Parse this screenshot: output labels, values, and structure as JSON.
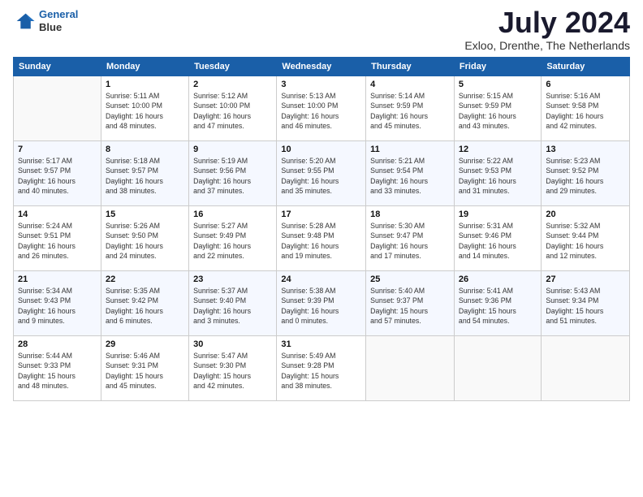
{
  "logo": {
    "line1": "General",
    "line2": "Blue"
  },
  "title": "July 2024",
  "subtitle": "Exloo, Drenthe, The Netherlands",
  "days_of_week": [
    "Sunday",
    "Monday",
    "Tuesday",
    "Wednesday",
    "Thursday",
    "Friday",
    "Saturday"
  ],
  "weeks": [
    [
      {
        "day": "",
        "info": ""
      },
      {
        "day": "1",
        "info": "Sunrise: 5:11 AM\nSunset: 10:00 PM\nDaylight: 16 hours\nand 48 minutes."
      },
      {
        "day": "2",
        "info": "Sunrise: 5:12 AM\nSunset: 10:00 PM\nDaylight: 16 hours\nand 47 minutes."
      },
      {
        "day": "3",
        "info": "Sunrise: 5:13 AM\nSunset: 10:00 PM\nDaylight: 16 hours\nand 46 minutes."
      },
      {
        "day": "4",
        "info": "Sunrise: 5:14 AM\nSunset: 9:59 PM\nDaylight: 16 hours\nand 45 minutes."
      },
      {
        "day": "5",
        "info": "Sunrise: 5:15 AM\nSunset: 9:59 PM\nDaylight: 16 hours\nand 43 minutes."
      },
      {
        "day": "6",
        "info": "Sunrise: 5:16 AM\nSunset: 9:58 PM\nDaylight: 16 hours\nand 42 minutes."
      }
    ],
    [
      {
        "day": "7",
        "info": "Sunrise: 5:17 AM\nSunset: 9:57 PM\nDaylight: 16 hours\nand 40 minutes."
      },
      {
        "day": "8",
        "info": "Sunrise: 5:18 AM\nSunset: 9:57 PM\nDaylight: 16 hours\nand 38 minutes."
      },
      {
        "day": "9",
        "info": "Sunrise: 5:19 AM\nSunset: 9:56 PM\nDaylight: 16 hours\nand 37 minutes."
      },
      {
        "day": "10",
        "info": "Sunrise: 5:20 AM\nSunset: 9:55 PM\nDaylight: 16 hours\nand 35 minutes."
      },
      {
        "day": "11",
        "info": "Sunrise: 5:21 AM\nSunset: 9:54 PM\nDaylight: 16 hours\nand 33 minutes."
      },
      {
        "day": "12",
        "info": "Sunrise: 5:22 AM\nSunset: 9:53 PM\nDaylight: 16 hours\nand 31 minutes."
      },
      {
        "day": "13",
        "info": "Sunrise: 5:23 AM\nSunset: 9:52 PM\nDaylight: 16 hours\nand 29 minutes."
      }
    ],
    [
      {
        "day": "14",
        "info": "Sunrise: 5:24 AM\nSunset: 9:51 PM\nDaylight: 16 hours\nand 26 minutes."
      },
      {
        "day": "15",
        "info": "Sunrise: 5:26 AM\nSunset: 9:50 PM\nDaylight: 16 hours\nand 24 minutes."
      },
      {
        "day": "16",
        "info": "Sunrise: 5:27 AM\nSunset: 9:49 PM\nDaylight: 16 hours\nand 22 minutes."
      },
      {
        "day": "17",
        "info": "Sunrise: 5:28 AM\nSunset: 9:48 PM\nDaylight: 16 hours\nand 19 minutes."
      },
      {
        "day": "18",
        "info": "Sunrise: 5:30 AM\nSunset: 9:47 PM\nDaylight: 16 hours\nand 17 minutes."
      },
      {
        "day": "19",
        "info": "Sunrise: 5:31 AM\nSunset: 9:46 PM\nDaylight: 16 hours\nand 14 minutes."
      },
      {
        "day": "20",
        "info": "Sunrise: 5:32 AM\nSunset: 9:44 PM\nDaylight: 16 hours\nand 12 minutes."
      }
    ],
    [
      {
        "day": "21",
        "info": "Sunrise: 5:34 AM\nSunset: 9:43 PM\nDaylight: 16 hours\nand 9 minutes."
      },
      {
        "day": "22",
        "info": "Sunrise: 5:35 AM\nSunset: 9:42 PM\nDaylight: 16 hours\nand 6 minutes."
      },
      {
        "day": "23",
        "info": "Sunrise: 5:37 AM\nSunset: 9:40 PM\nDaylight: 16 hours\nand 3 minutes."
      },
      {
        "day": "24",
        "info": "Sunrise: 5:38 AM\nSunset: 9:39 PM\nDaylight: 16 hours\nand 0 minutes."
      },
      {
        "day": "25",
        "info": "Sunrise: 5:40 AM\nSunset: 9:37 PM\nDaylight: 15 hours\nand 57 minutes."
      },
      {
        "day": "26",
        "info": "Sunrise: 5:41 AM\nSunset: 9:36 PM\nDaylight: 15 hours\nand 54 minutes."
      },
      {
        "day": "27",
        "info": "Sunrise: 5:43 AM\nSunset: 9:34 PM\nDaylight: 15 hours\nand 51 minutes."
      }
    ],
    [
      {
        "day": "28",
        "info": "Sunrise: 5:44 AM\nSunset: 9:33 PM\nDaylight: 15 hours\nand 48 minutes."
      },
      {
        "day": "29",
        "info": "Sunrise: 5:46 AM\nSunset: 9:31 PM\nDaylight: 15 hours\nand 45 minutes."
      },
      {
        "day": "30",
        "info": "Sunrise: 5:47 AM\nSunset: 9:30 PM\nDaylight: 15 hours\nand 42 minutes."
      },
      {
        "day": "31",
        "info": "Sunrise: 5:49 AM\nSunset: 9:28 PM\nDaylight: 15 hours\nand 38 minutes."
      },
      {
        "day": "",
        "info": ""
      },
      {
        "day": "",
        "info": ""
      },
      {
        "day": "",
        "info": ""
      }
    ]
  ]
}
